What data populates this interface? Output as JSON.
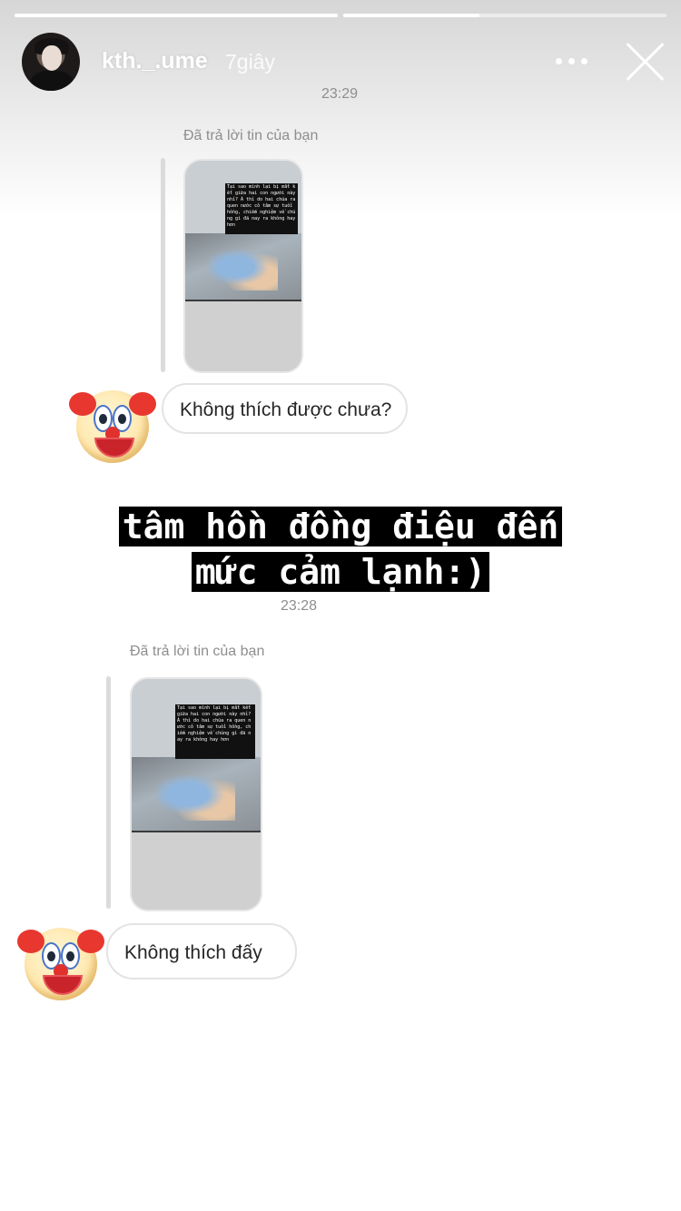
{
  "story": {
    "username": "kth._.ume",
    "posted_ago": "7giây",
    "progress_segments": [
      {
        "fill_fraction": 1.0
      },
      {
        "fill_fraction": 0.4
      }
    ]
  },
  "messages": [
    {
      "timestamp": "23:29",
      "reply_label": "Đã trả lời tin của bạn",
      "thumb_caption": "Tại sao mình lại bị mất kết giữa hai con người này nhỉ? À thì do hai chúa ra quen nước cỏ tâm sự tuổi hồng, chiếm nghiệm về chúng gì đã nay ra không hay hơn",
      "reply_text": "Không thích được chưa?"
    },
    {
      "timestamp": "23:28",
      "reply_label": "Đã trả lời tin của bạn",
      "thumb_caption": "Tại sao mình lại bị mất kết giữa hai con người này nhỉ? À thì do hai chúa ra quen nước cỏ tâm sự tuổi hồng, chiếm nghiệm về chúng gì đã nay ra không hay hơn",
      "reply_text": "Không thích đấy"
    }
  ],
  "overlay_caption": {
    "line1": "tâm hồn đồng điệu đến",
    "line2": "mức cảm lạnh:)"
  },
  "icons": {
    "close": "close-icon",
    "more": "more-icon",
    "reaction": "clown-emoji"
  }
}
